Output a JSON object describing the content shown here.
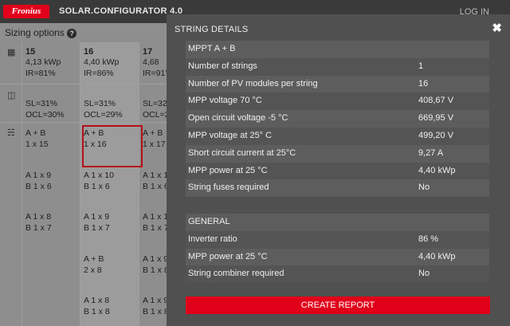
{
  "header": {
    "logo_text": "Fronius",
    "app_title": "SOLAR.CONFIGURATOR 4.0",
    "login_label": "LOG IN"
  },
  "background": {
    "sizing_label": "Sizing options",
    "columns": [
      {
        "modules": "15",
        "power": "4,13 kWp",
        "ir": "IR=81%",
        "sl": "SL=31%",
        "ocl": "OCL=30%",
        "configs": [
          [
            "A + B",
            "1 x 15"
          ],
          [
            "A 1 x 9",
            "B 1 x 6"
          ],
          [
            "A 1 x 8",
            "B 1 x 7"
          ]
        ]
      },
      {
        "modules": "16",
        "power": "4,40 kWp",
        "ir": "IR=86%",
        "sl": "SL=31%",
        "ocl": "OCL=29%",
        "configs": [
          [
            "A + B",
            "1 x 16"
          ],
          [
            "A 1 x 10",
            "B 1 x 6"
          ],
          [
            "A 1 x 9",
            "B 1 x 7"
          ],
          [
            "A + B",
            "2 x 8"
          ],
          [
            "A 1 x 8",
            "B 1 x 8"
          ]
        ]
      },
      {
        "modules": "17",
        "power": "4,68",
        "ir": "IR=91°",
        "sl": "SL=32",
        "ocl": "OCL=2",
        "configs": [
          [
            "A + B",
            "1 x 17"
          ],
          [
            "A 1 x 1",
            "B 1 x 6"
          ],
          [
            "A 1 x 1",
            "B 1 x 7"
          ],
          [
            "A 1 x 9",
            "B 1 x 8"
          ],
          [
            "A 1 x 9",
            "B 1 x 8"
          ]
        ]
      }
    ]
  },
  "modal": {
    "title": "STRING DETAILS",
    "close_icon": "close-icon",
    "mppt_section": {
      "title": "MPPT A + B",
      "rows": [
        {
          "label": "Number of strings",
          "value": "1"
        },
        {
          "label": "Number of PV modules per string",
          "value": "16"
        },
        {
          "label": "MPP voltage 70 °C",
          "value": "408,67 V"
        },
        {
          "label": "Open circuit voltage -5 °C",
          "value": "669,95 V"
        },
        {
          "label": "MPP voltage at 25° C",
          "value": "499,20 V"
        },
        {
          "label": "Short circuit current at 25°C",
          "value": "9,27 A"
        },
        {
          "label": "MPP power at 25 °C",
          "value": "4,40 kWp"
        },
        {
          "label": "String fuses required",
          "value": "No"
        }
      ]
    },
    "general_section": {
      "title": "GENERAL",
      "rows": [
        {
          "label": "Inverter ratio",
          "value": "86 %"
        },
        {
          "label": "MPP power at 25 °C",
          "value": "4,40 kWp"
        },
        {
          "label": "String combiner required",
          "value": "No"
        }
      ]
    },
    "create_report_label": "CREATE REPORT"
  },
  "colors": {
    "brand_red": "#e1001a",
    "modal_bg": "#505050",
    "topbar_bg": "#3a3a3a"
  }
}
